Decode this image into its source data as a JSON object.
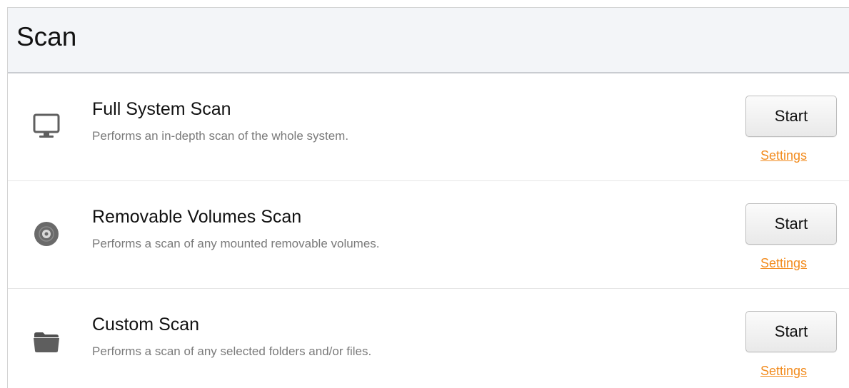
{
  "header": {
    "title": "Scan"
  },
  "colors": {
    "accent_link": "#f28b1d",
    "header_bg": "#f3f5f8",
    "icon_gray": "#5f5f5f"
  },
  "scans": [
    {
      "icon": "monitor-icon",
      "title": "Full System Scan",
      "description": "Performs an in-depth scan of the whole system.",
      "start_label": "Start",
      "settings_label": "Settings"
    },
    {
      "icon": "disc-icon",
      "title": "Removable Volumes Scan",
      "description": "Performs a scan of any mounted removable volumes.",
      "start_label": "Start",
      "settings_label": "Settings"
    },
    {
      "icon": "folder-icon",
      "title": "Custom Scan",
      "description": "Performs a scan of any selected folders and/or files.",
      "start_label": "Start",
      "settings_label": "Settings"
    }
  ]
}
